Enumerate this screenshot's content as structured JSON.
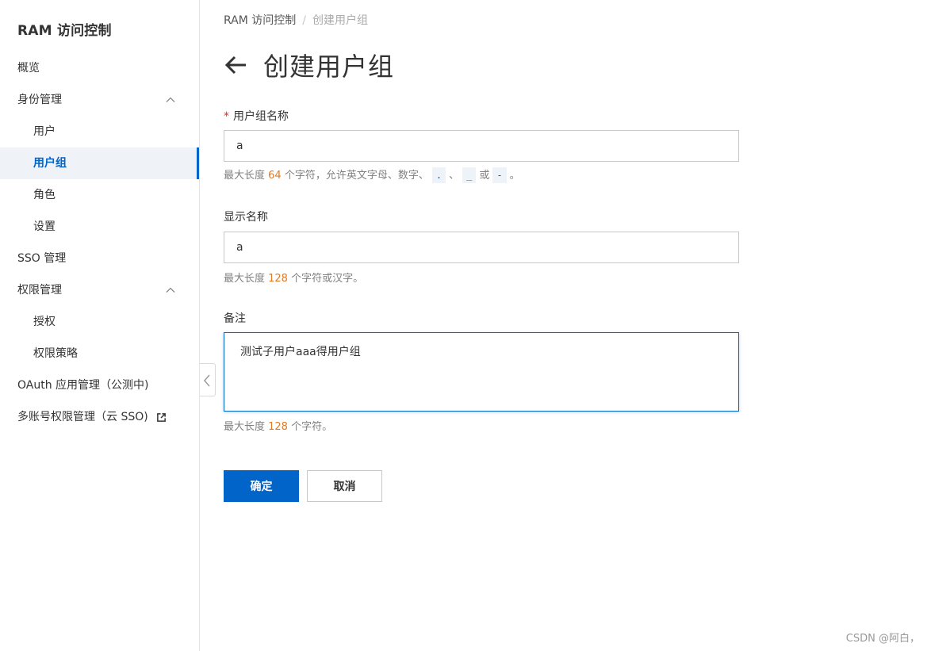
{
  "sidebar": {
    "brand": "RAM 访问控制",
    "items": [
      {
        "label": "概览"
      },
      {
        "label": "身份管理"
      },
      {
        "label": "用户"
      },
      {
        "label": "用户组"
      },
      {
        "label": "角色"
      },
      {
        "label": "设置"
      },
      {
        "label": "SSO 管理"
      },
      {
        "label": "权限管理"
      },
      {
        "label": "授权"
      },
      {
        "label": "权限策略"
      },
      {
        "label": "OAuth 应用管理（公测中)"
      },
      {
        "label": "多账号权限管理（云 SSO)"
      }
    ],
    "active_item": "用户组",
    "expanded_groups": [
      "身份管理",
      "权限管理"
    ]
  },
  "breadcrumb": {
    "root": "RAM 访问控制",
    "separator": "/",
    "current": "创建用户组"
  },
  "page": {
    "title": "创建用户组"
  },
  "form": {
    "group_name": {
      "required_mark": "*",
      "label": "用户组名称",
      "value": "a",
      "help_prefix": "最大长度 ",
      "help_limit": "64",
      "help_middle": " 个字符，允许英文字母、数字、",
      "char_dot": ".",
      "sep1": "、",
      "char_underscore": "_",
      "or_text": "或",
      "char_dash": "-",
      "help_end": "。"
    },
    "display_name": {
      "label": "显示名称",
      "value": "a",
      "help_prefix": "最大长度 ",
      "help_limit": "128",
      "help_suffix": " 个字符或汉字。"
    },
    "remark": {
      "label": "备注",
      "value": "测试子用户aaa得用户组",
      "help_prefix": "最大长度 ",
      "help_limit": "128",
      "help_suffix": " 个字符。"
    }
  },
  "actions": {
    "confirm_label": "确定",
    "cancel_label": "取消"
  },
  "watermark": "CSDN @阿白，",
  "colors": {
    "accent": "#0064c8",
    "required": "#d93026",
    "highlight_number": "#e07a25",
    "active_item_bg": "#eff3f8"
  },
  "icons": {
    "back": "arrow-left-icon",
    "group_toggle": "chevron-up-icon",
    "external_link": "external-link-icon",
    "collapse_sidebar": "chevron-left-icon"
  }
}
